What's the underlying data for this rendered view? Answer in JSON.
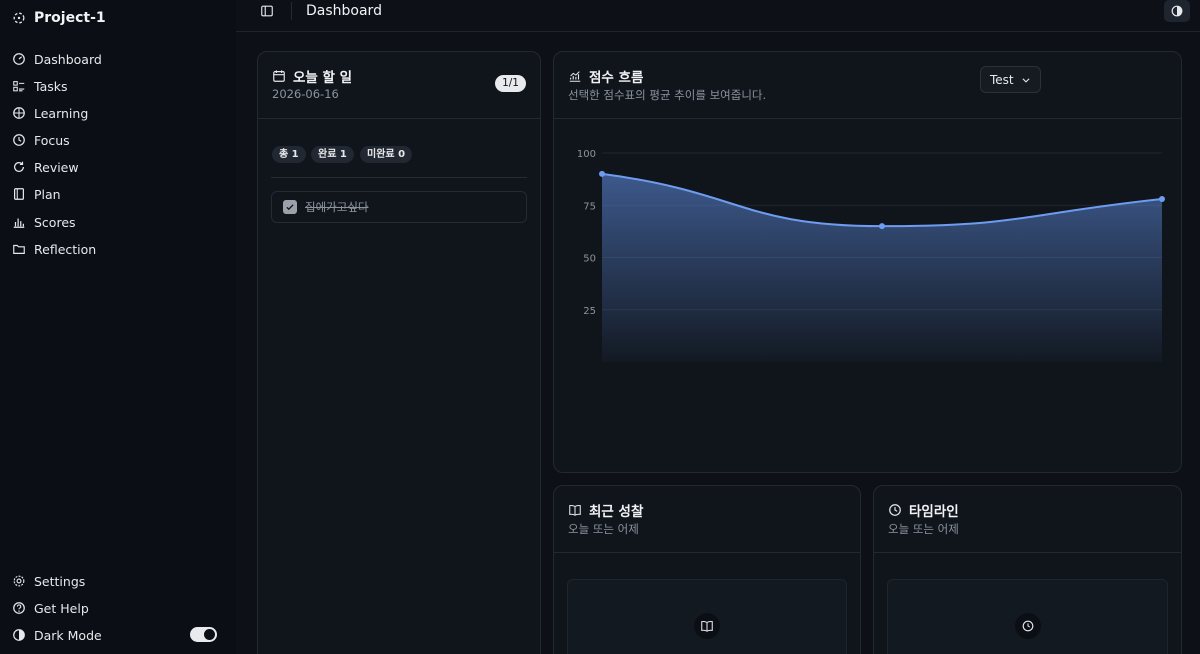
{
  "sidebar": {
    "brand": "Project-1",
    "nav": [
      {
        "label": "Dashboard",
        "icon": "gauge-icon"
      },
      {
        "label": "Tasks",
        "icon": "list-checks-icon"
      },
      {
        "label": "Learning",
        "icon": "brain-icon"
      },
      {
        "label": "Focus",
        "icon": "clock-icon"
      },
      {
        "label": "Review",
        "icon": "refresh-icon"
      },
      {
        "label": "Plan",
        "icon": "book-icon"
      },
      {
        "label": "Scores",
        "icon": "bar-chart-icon"
      },
      {
        "label": "Reflection",
        "icon": "folder-icon"
      }
    ],
    "footer": [
      {
        "label": "Settings",
        "icon": "gear-icon"
      },
      {
        "label": "Get Help",
        "icon": "help-circle-icon"
      },
      {
        "label": "Dark Mode",
        "icon": "contrast-icon"
      }
    ],
    "dark_mode_on": true
  },
  "header": {
    "title": "Dashboard"
  },
  "today": {
    "title": "오늘 할 일",
    "date": "2026-06-16",
    "count_badge": "1/1",
    "chips": [
      "총 1",
      "완료 1",
      "미완료 0"
    ],
    "todos": [
      {
        "text": "집에가고싶다",
        "done": true
      }
    ]
  },
  "scores": {
    "title": "점수 흐름",
    "subtitle": "선택한 점수표의 평균 추이를 보여줍니다.",
    "select_value": "Test"
  },
  "reflection": {
    "title": "최근 성찰",
    "subtitle": "오늘 또는 어제"
  },
  "timeline": {
    "title": "타임라인",
    "subtitle": "오늘 또는 어제"
  },
  "colors": {
    "accent": "#6e9cf0",
    "background": "#0d1117",
    "card": "#10151c"
  },
  "chart_data": {
    "type": "area",
    "title": "",
    "xlabel": "",
    "ylabel": "",
    "ylim": [
      0,
      100
    ],
    "y_ticks": [
      "100",
      "75",
      "50",
      "25"
    ],
    "values": [
      90,
      65,
      78
    ],
    "grid": true
  }
}
